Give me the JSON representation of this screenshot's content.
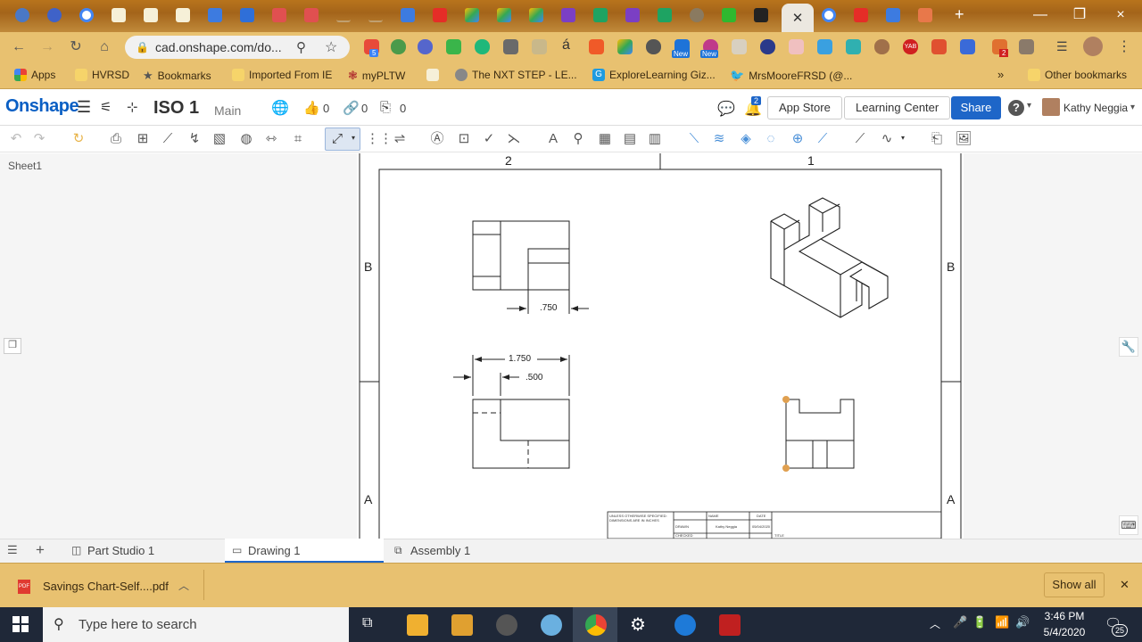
{
  "browser": {
    "url": "cad.onshape.com/do...",
    "window_close": "×",
    "bookmarks": [
      "Apps",
      "HVRSD",
      "Bookmarks",
      "Imported From IE",
      "myPLTW",
      "The NXT STEP - LE...",
      "ExploreLearning Giz...",
      "MrsMooreFRSD (@...",
      "Other bookmarks"
    ],
    "more_bookmarks": "»",
    "ext_badges": {
      "badge1": "5",
      "new1": "New",
      "new2": "New",
      "yab": "YAB",
      "badge2": "2"
    }
  },
  "onshape": {
    "logo": "Onshape",
    "document_name": "ISO 1",
    "workspace": "Main",
    "likes": "0",
    "links": "0",
    "copies": "0",
    "notifications": "2",
    "app_store": "App Store",
    "learning_center": "Learning Center",
    "share": "Share",
    "help": "?",
    "user": "Kathy Neggia"
  },
  "drawing": {
    "sheet": "Sheet1",
    "zone_columns": [
      "2",
      "1"
    ],
    "zone_rows": [
      "B",
      "A"
    ],
    "dim_750": ".750",
    "dim_1750": "1.750",
    "dim_500": ".500",
    "title_block": {
      "notes": "UNLESS OTHERWISE SPECIFIED: DIMENSIONS ARE IN INCHES",
      "name_header": "NAME",
      "date_header": "DATE",
      "drawn": "DRAWN",
      "checked": "CHECKED",
      "drawn_name": "Kathy Neggia",
      "drawn_date": "05/04/2020",
      "title": "TITLE"
    }
  },
  "doc_tabs": [
    "Part Studio 1",
    "Drawing 1",
    "Assembly 1"
  ],
  "download": {
    "file": "Savings Chart-Self....pdf",
    "show_all": "Show all",
    "close": "✕"
  },
  "taskbar": {
    "search_placeholder": "Type here to search",
    "time": "3:46 PM",
    "date": "5/4/2020",
    "notif_count": "25"
  },
  "colors": {
    "brand_blue": "#0a5fc4",
    "share_blue": "#1e66c8",
    "chrome_tan": "#e8c170",
    "taskbar": "#1f2838"
  }
}
